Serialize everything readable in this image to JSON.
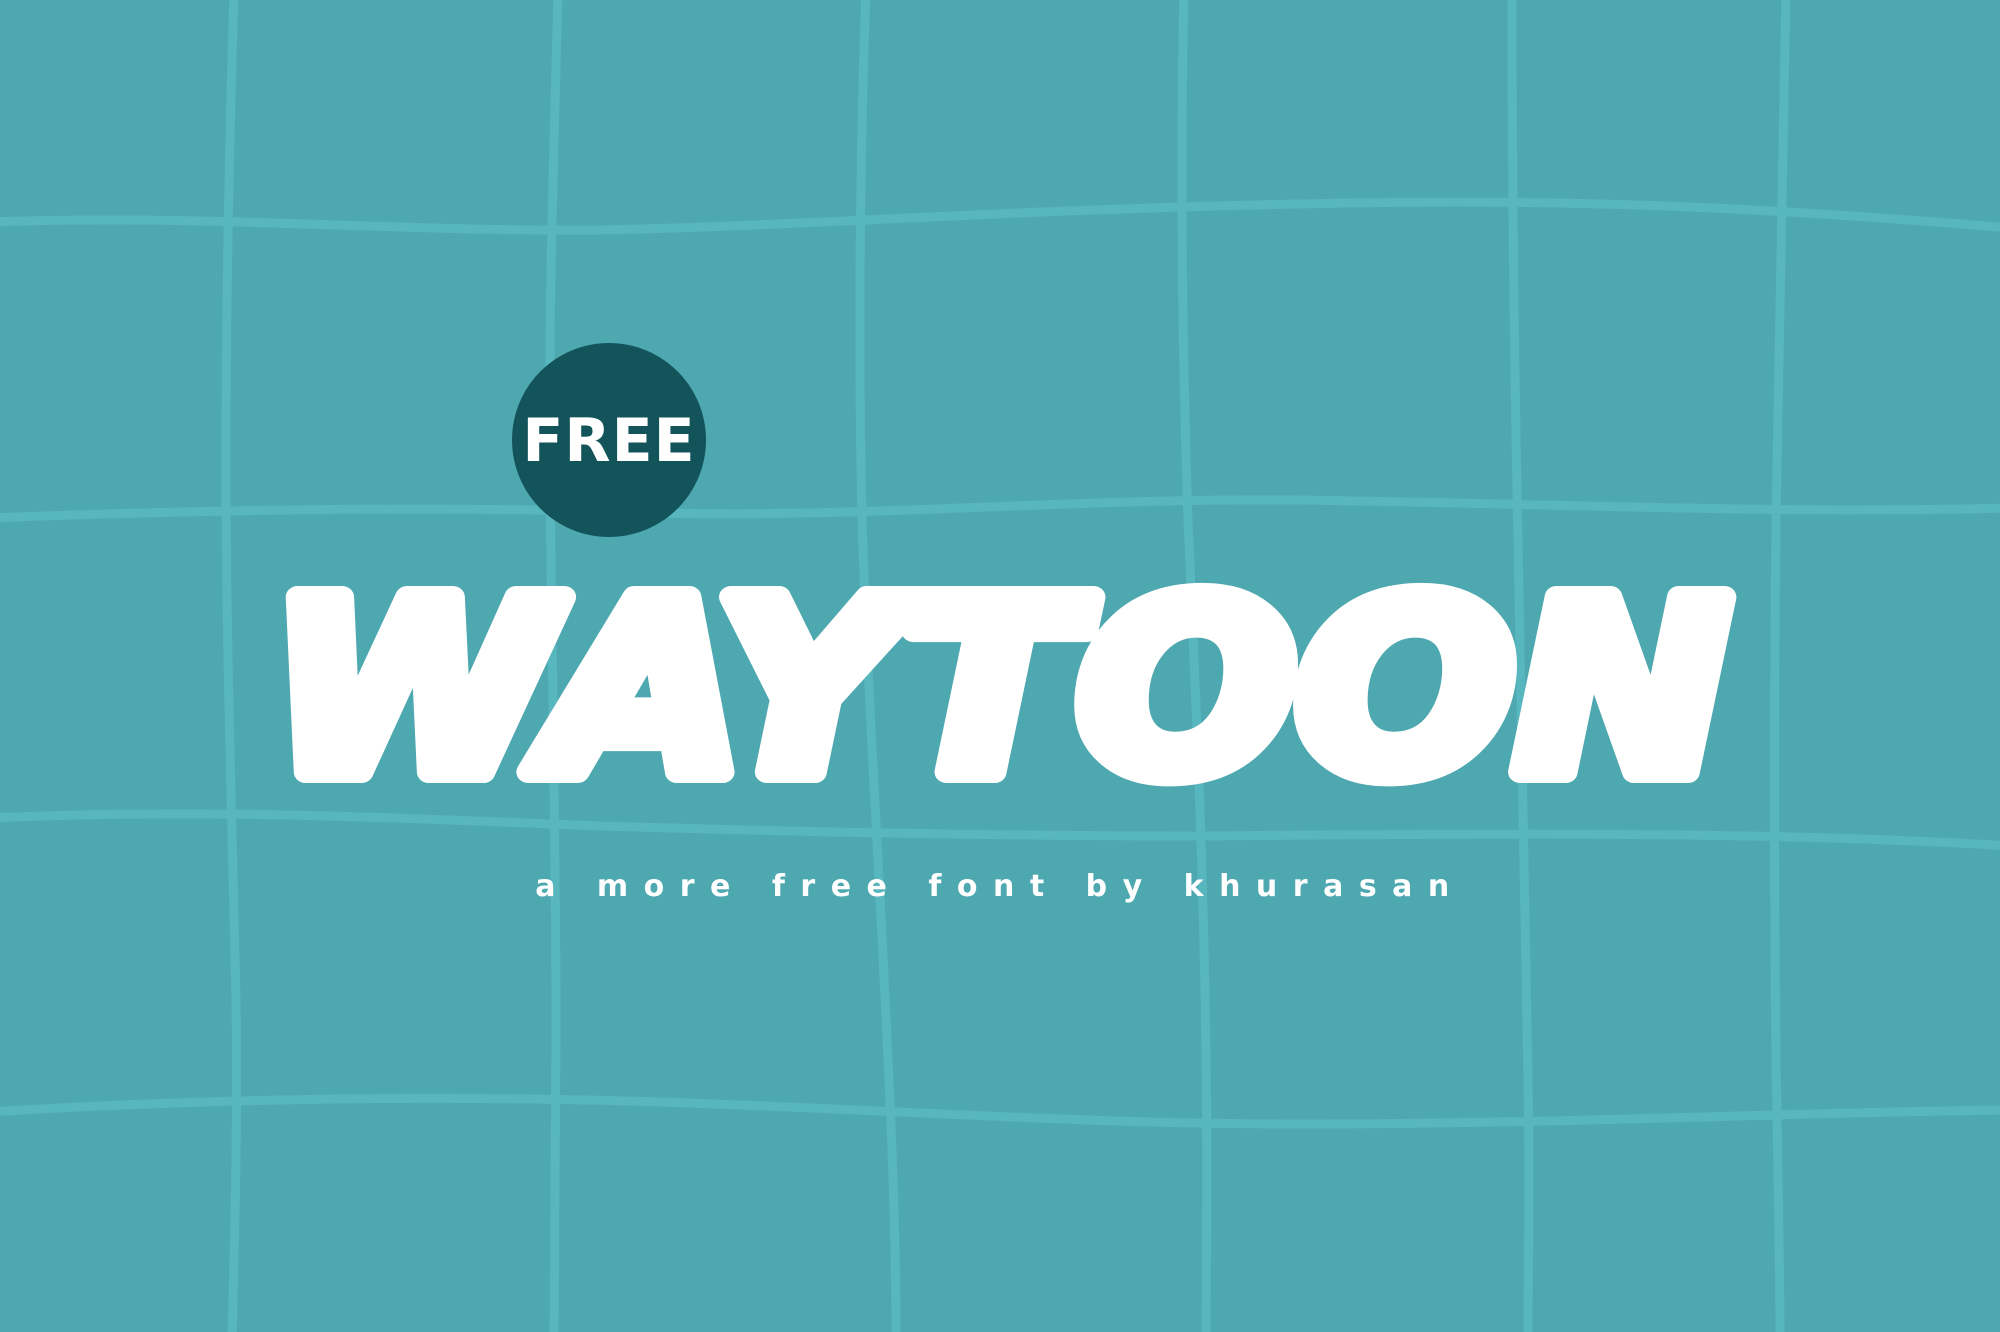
{
  "badge": {
    "label": "FREE"
  },
  "title": {
    "text": "WAYTOON"
  },
  "tagline": {
    "text": "a more free font by khurasan"
  },
  "colors": {
    "background": "#4ea8b0",
    "grid_lines": "#58b6be",
    "badge": "#13545b",
    "text": "#ffffff"
  }
}
